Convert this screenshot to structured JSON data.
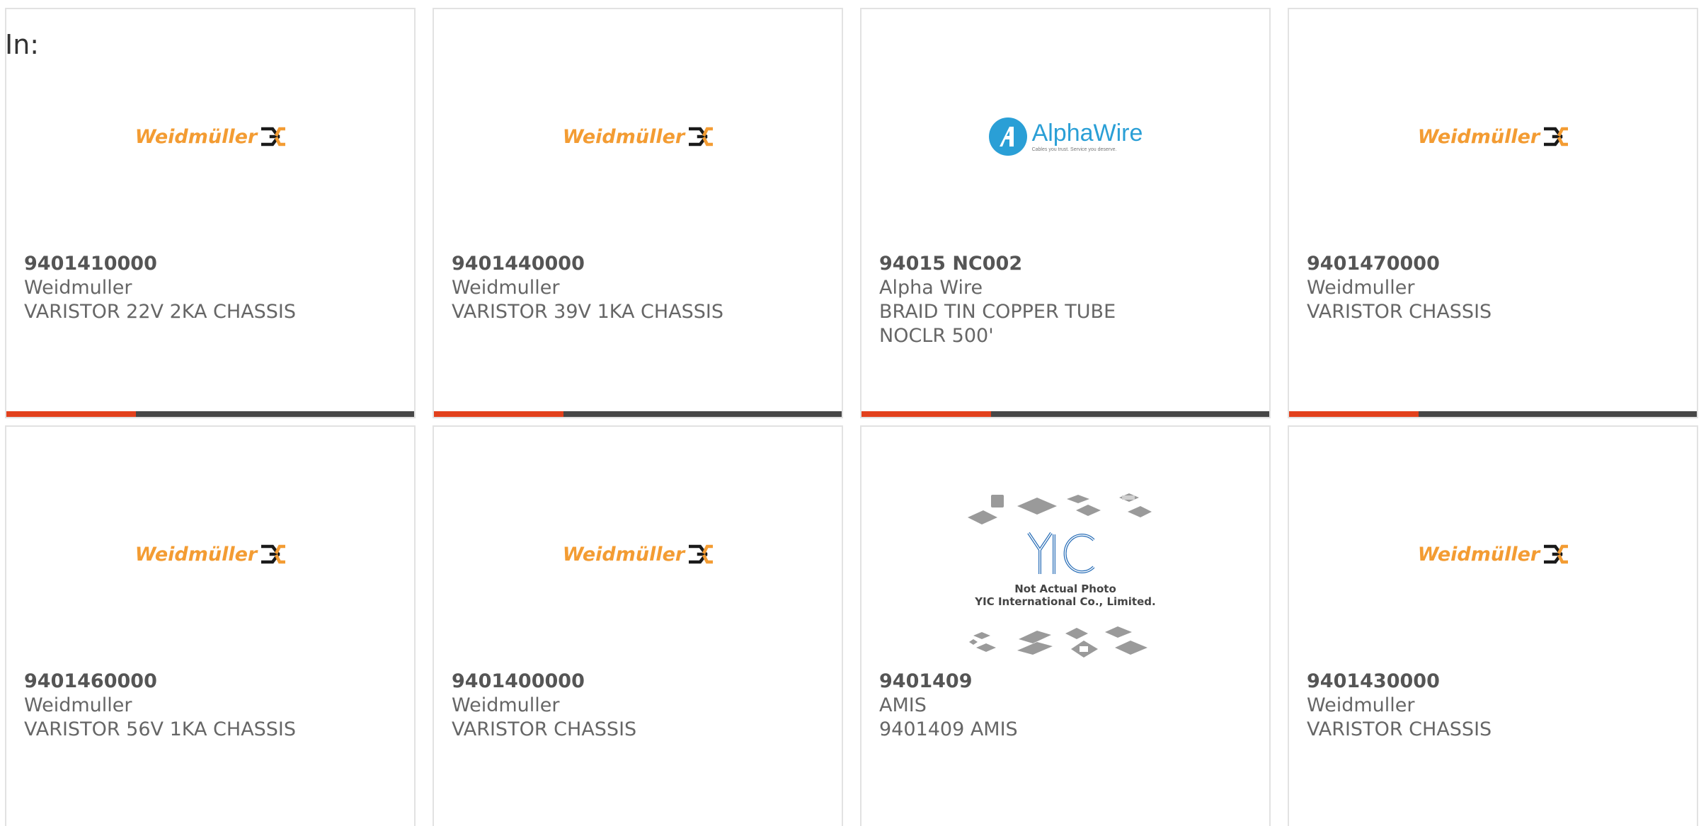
{
  "header": {
    "in_label": "In:"
  },
  "colors": {
    "accent_bar": "#e2401c",
    "dark_bar": "#474747",
    "weidmuller_orange": "#f39c33",
    "alphawire_blue": "#2a9fd6"
  },
  "logos": {
    "weidmuller": {
      "text": "Weidmüller",
      "icon": "weidmuller-symbol-icon"
    },
    "alphawire": {
      "text": "AlphaWire",
      "tagline": "Cables you trust. Service you deserve.",
      "icon": "alphawire-a-icon"
    },
    "yic": {
      "line1": "Not Actual Photo",
      "line2": "YIC International Co., Limited.",
      "icon": "yic-logo-icon"
    }
  },
  "products": [
    {
      "part_number": "9401410000",
      "manufacturer": "Weidmuller",
      "description": "VARISTOR 22V 2KA CHASSIS"
    },
    {
      "part_number": "9401440000",
      "manufacturer": "Weidmuller",
      "description": "VARISTOR 39V 1KA CHASSIS"
    },
    {
      "part_number": "94015 NC002",
      "manufacturer": "Alpha Wire",
      "description": "BRAID TIN COPPER TUBE NOCLR 500'"
    },
    {
      "part_number": "9401470000",
      "manufacturer": "Weidmuller",
      "description": "VARISTOR CHASSIS"
    },
    {
      "part_number": "9401460000",
      "manufacturer": "Weidmuller",
      "description": "VARISTOR 56V 1KA CHASSIS"
    },
    {
      "part_number": "9401400000",
      "manufacturer": "Weidmuller",
      "description": "VARISTOR CHASSIS"
    },
    {
      "part_number": "9401409",
      "manufacturer": "AMIS",
      "description": "9401409 AMIS"
    },
    {
      "part_number": "9401430000",
      "manufacturer": "Weidmuller",
      "description": "VARISTOR CHASSIS"
    }
  ]
}
